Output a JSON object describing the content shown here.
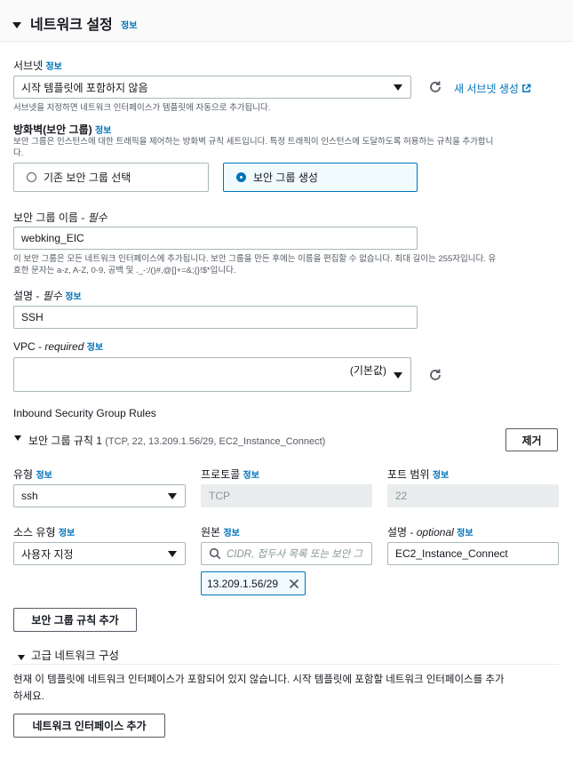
{
  "section": {
    "title": "네트워크 설정",
    "info": "정보"
  },
  "subnet": {
    "label": "서브넷",
    "info": "정보",
    "value": "시작 템플릿에 포함하지 않음",
    "hint": "서브넷을 지정하면 네트워크 인터페이스가 템플릿에 자동으로 추가됩니다.",
    "create_link": "새 서브넷 생성"
  },
  "firewall": {
    "label": "방화벽(보안 그룹)",
    "info": "정보",
    "desc_line1": "보안 그룹은 인스턴스에 대한 트래픽을 제어하는 방화벽 규칙 세트입니다. 특정 트래픽이 인스턴스에 도달하도록 허용하는 규칙을 추가합니",
    "desc_line2": "다.",
    "option_existing": "기존 보안 그룹 선택",
    "option_create": "보안 그룹 생성",
    "selected": "create"
  },
  "sg_name": {
    "label": "보안 그룹 이름 - ",
    "required": "필수",
    "value": "webking_EIC",
    "hint_line1": "이 보안 그룹은 모든 네트워크 인터페이스에 추가됩니다. 보안 그룹을 만든 후에는 이름을 편집할 수 없습니다. 최대 길이는 255자입니다. 유",
    "hint_line2": "효한 문자는 a-z, A-Z, 0-9, 공백 및 ._-:/()#,@[]+=&;{}!$*입니다."
  },
  "description": {
    "label": "설명 - ",
    "required": "필수",
    "info": "정보",
    "value": "SSH"
  },
  "vpc": {
    "label": "VPC - ",
    "required": "required",
    "info": "정보",
    "value": "(기본값)"
  },
  "inbound": {
    "title": "Inbound Security Group Rules",
    "rule_title": "보안 그룹 규칙 1",
    "rule_summary": "(TCP, 22, 13.209.1.56/29, EC2_Instance_Connect)",
    "remove_button": "제거",
    "type_label": "유형",
    "type_info": "정보",
    "type_value": "ssh",
    "protocol_label": "프로토콜",
    "protocol_info": "정보",
    "protocol_value": "TCP",
    "port_label": "포트 범위",
    "port_info": "정보",
    "port_value": "22",
    "source_type_label": "소스 유형",
    "source_type_info": "정보",
    "source_type_value": "사용자 지정",
    "source_label": "원본",
    "source_info": "정보",
    "source_placeholder": "CIDR, 접두사 목록 또는 보안 그",
    "source_token": "13.209.1.56/29",
    "rule_desc_label": "설명 - ",
    "rule_desc_optional": "optional",
    "rule_desc_info": "정보",
    "rule_desc_value": "EC2_Instance_Connect",
    "add_rule_button": "보안 그룹 규칙 추가"
  },
  "advanced": {
    "title": "고급 네트워크 구성",
    "desc_line1": "현재 이 템플릿에 네트워크 인터페이스가 포함되어 있지 않습니다. 시작 템플릿에 포함할 네트워크 인터페이스를 추가",
    "desc_line2": "하세요.",
    "add_interface_button": "네트워크 인터페이스 추가"
  },
  "colors": {
    "link": "#0073bb",
    "selected_border": "#0073bb",
    "selected_bg": "#f1faff"
  }
}
